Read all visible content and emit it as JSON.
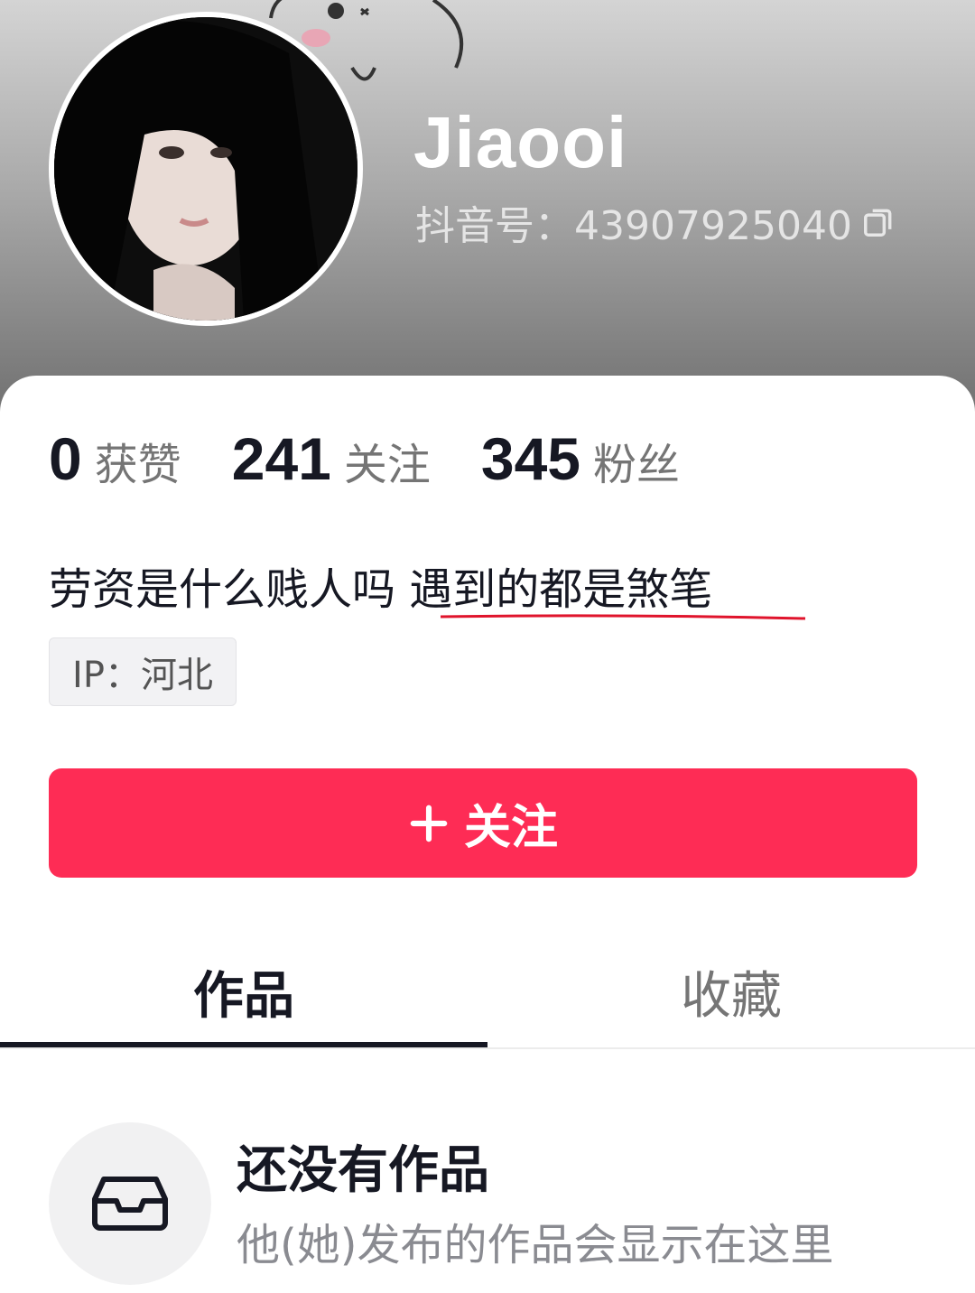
{
  "profile": {
    "username": "Jiaooi",
    "douyin_id": "抖音号：43907925040",
    "copy_icon": "copy-icon"
  },
  "stats": [
    {
      "value": "0",
      "label": "获赞"
    },
    {
      "value": "241",
      "label": "关注"
    },
    {
      "value": "345",
      "label": "粉丝"
    }
  ],
  "bio": {
    "text": "劳资是什么贱人吗 遇到的都是煞笔",
    "underline_color": "#e0142c"
  },
  "ip": {
    "label": "IP：河北"
  },
  "follow_button": {
    "label": "关注",
    "icon": "plus-icon",
    "color": "#fe2c55"
  },
  "tabs": [
    {
      "label": "作品",
      "active": true
    },
    {
      "label": "收藏",
      "active": false
    }
  ],
  "empty_state": {
    "icon": "inbox-tray-icon",
    "title": "还没有作品",
    "subtitle": "他(她)发布的作品会显示在这里"
  }
}
